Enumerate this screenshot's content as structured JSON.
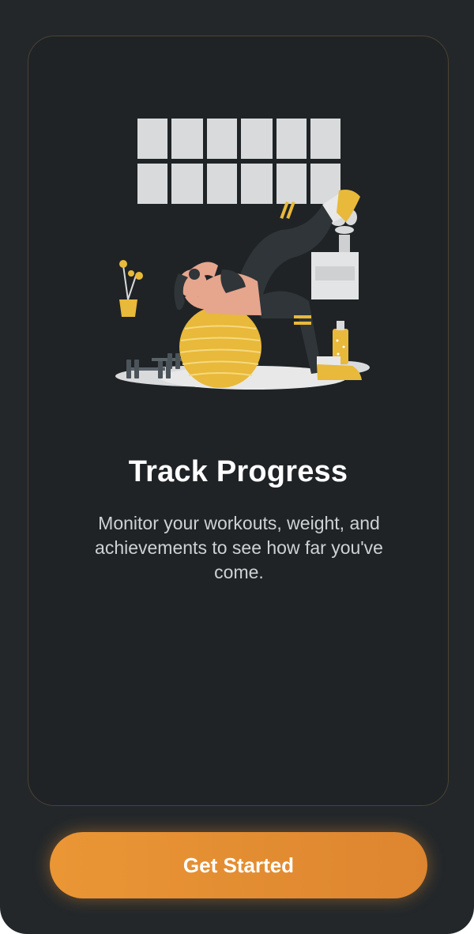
{
  "onboarding": {
    "title": "Track Progress",
    "description": "Monitor your workouts, weight, and achievements to see how far you've come.",
    "illustration": "woman-exercising-on-yoga-ball-illustration"
  },
  "actions": {
    "get_started_label": "Get Started"
  },
  "colors": {
    "background": "#23272a",
    "card": "#1f2326",
    "accent": "#ea9635",
    "illustration_yellow": "#e8b93a"
  }
}
